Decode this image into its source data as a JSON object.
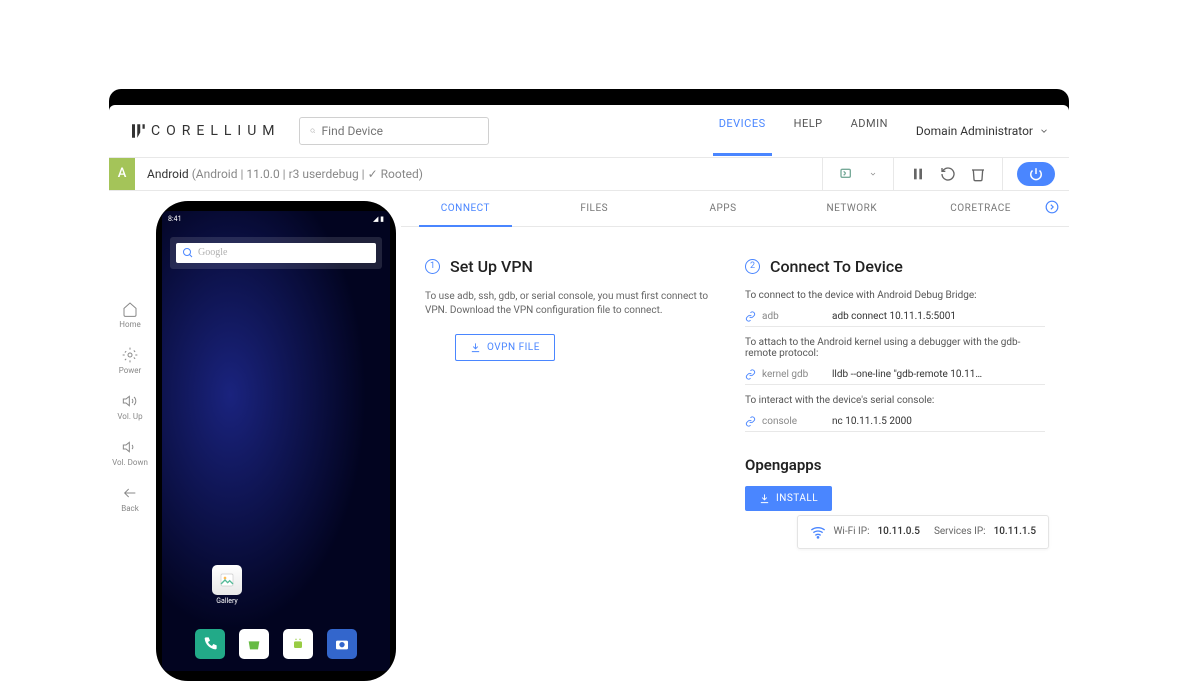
{
  "brand": "CORELLIUM",
  "search": {
    "placeholder": "Find Device"
  },
  "nav": {
    "devices": "DEVICES",
    "help": "HELP",
    "admin": "ADMIN"
  },
  "user": "Domain Administrator",
  "device": {
    "badge": "A",
    "name": "Android",
    "meta": "(Android  |  11.0.0  |  r3 userdebug  |  ✓ Rooted)"
  },
  "sidebar": {
    "home": "Home",
    "power": "Power",
    "volup": "Vol. Up",
    "voldown": "Vol. Down",
    "back": "Back"
  },
  "phone": {
    "time": "8:41",
    "search_placeholder": "Google",
    "gallery": "Gallery"
  },
  "tabs": {
    "connect": "CONNECT",
    "files": "FILES",
    "apps": "APPS",
    "network": "NETWORK",
    "coretrace": "CORETRACE"
  },
  "vpn": {
    "step": "1",
    "title": "Set Up VPN",
    "desc": "To use adb, ssh, gdb, or serial console, you must first connect to VPN. Download the VPN configuration file to connect.",
    "button": "OVPN FILE"
  },
  "connect": {
    "step": "2",
    "title": "Connect To Device",
    "adb_desc": "To connect to the device with Android Debug Bridge:",
    "adb_label": "adb",
    "adb_cmd": "adb connect 10.11.1.5:5001",
    "gdb_desc": "To attach to the Android kernel using a debugger with the gdb-remote protocol:",
    "gdb_label": "kernel gdb",
    "gdb_cmd": "lldb --one-line \"gdb-remote 10.11…",
    "console_desc": "To interact with the device's serial console:",
    "console_label": "console",
    "console_cmd": "nc 10.11.1.5 2000"
  },
  "opengapps": {
    "title": "Opengapps",
    "button": "INSTALL"
  },
  "ip": {
    "wifi_label": "Wi-Fi IP:",
    "wifi_value": "10.11.0.5",
    "svc_label": "Services IP:",
    "svc_value": "10.11.1.5"
  }
}
